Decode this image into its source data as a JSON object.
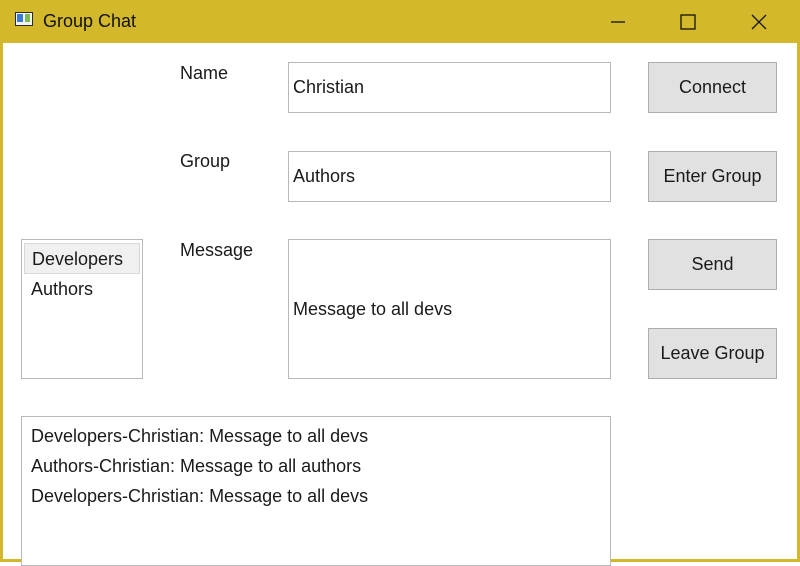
{
  "window": {
    "title": "Group Chat"
  },
  "form": {
    "name_label": "Name",
    "name_value": "Christian",
    "group_label": "Group",
    "group_value": "Authors",
    "message_label": "Message",
    "message_value": "Message to all devs"
  },
  "buttons": {
    "connect": "Connect",
    "enter_group": "Enter Group",
    "send": "Send",
    "leave_group": "Leave Group"
  },
  "groups": {
    "items": [
      {
        "label": "Developers",
        "selected": true
      },
      {
        "label": "Authors",
        "selected": false
      }
    ]
  },
  "messages": {
    "lines": [
      "Developers-Christian: Message to all devs",
      "Authors-Christian: Message to all authors",
      "Developers-Christian: Message to all devs"
    ]
  },
  "colors": {
    "titlebar": "#d4b82c",
    "button": "#e1e1e1"
  }
}
